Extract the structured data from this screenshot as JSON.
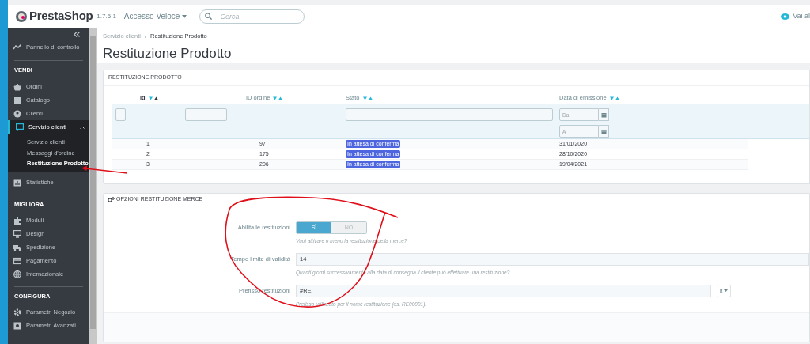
{
  "header": {
    "logo": "PrestaShop",
    "version": "1.7.5.1",
    "quick_access": "Accesso Veloce",
    "search": {
      "placeholder": "Cerca"
    },
    "view_shop": "Vai al"
  },
  "sidebar": {
    "groups": [
      {
        "items": [
          {
            "label": "Pannello di controllo",
            "selected": false
          }
        ]
      },
      {
        "heading": "VENDI",
        "items": [
          {
            "label": "Ordini",
            "selected": false
          },
          {
            "label": "Catalogo",
            "selected": false
          },
          {
            "label": "Clienti",
            "selected": false
          },
          {
            "label": "Servizio clienti",
            "selected": true,
            "expanded": true,
            "children": [
              {
                "label": "Servizio clienti",
                "selected": false
              },
              {
                "label": "Messaggi d'ordine",
                "selected": false
              },
              {
                "label": "Restituzione Prodotto",
                "selected": true
              }
            ]
          },
          {
            "label": "Statistiche",
            "selected": false
          }
        ]
      },
      {
        "heading": "MIGLIORA",
        "items": [
          {
            "label": "Moduli",
            "selected": false
          },
          {
            "label": "Design",
            "selected": false
          },
          {
            "label": "Spedizione",
            "selected": false
          },
          {
            "label": "Pagamento",
            "selected": false
          },
          {
            "label": "Internazionale",
            "selected": false
          }
        ]
      },
      {
        "heading": "CONFIGURA",
        "items": [
          {
            "label": "Parametri Negozio",
            "selected": false
          },
          {
            "label": "Parametri Avanzati",
            "selected": false
          }
        ]
      }
    ]
  },
  "breadcrumb": [
    "Servizio clienti",
    "Restituzione Prodotto"
  ],
  "breadcrumb_separator": "/",
  "page_title": "Restituzione Prodotto",
  "returns_panel": {
    "title": "RESTITUZIONE PRODOTTO",
    "table": {
      "columns": [
        {
          "label": "Id",
          "sorted": true
        },
        {
          "label": "ID ordine",
          "sorted": false
        },
        {
          "label": "Stato",
          "sorted": false
        },
        {
          "label": "Data di emissione",
          "sorted": false
        }
      ],
      "filters": [
        {
          "kind": "checkbox",
          "checked": false
        },
        {
          "kind": "text"
        },
        {
          "kind": "text"
        },
        {
          "kind": "date_range",
          "from_placeholder": "Da",
          "to_placeholder": "A"
        }
      ],
      "rows": [
        {
          "id": "1",
          "order_id": "97",
          "status": "In attesa di conferma",
          "date": "31/01/2020"
        },
        {
          "id": "2",
          "order_id": "175",
          "status": "In attesa di conferma",
          "date": "28/10/2020"
        },
        {
          "id": "3",
          "order_id": "206",
          "status": "In attesa di conferma",
          "date": "19/04/2021"
        }
      ]
    }
  },
  "options_panel": {
    "title": "OPZIONI RESTITUZIONE MERCE",
    "fields": [
      {
        "kind": "toggle",
        "label": "Abilita le restituzioni",
        "options": [
          {
            "label": "SÌ",
            "selected": true
          },
          {
            "label": "NO",
            "selected": false
          }
        ],
        "help": "Vuoi attivare o meno la restituzione della merce?"
      },
      {
        "kind": "text",
        "label": "Tempo limite di validità",
        "value": "14",
        "help": "Quanti giorni successivamente alla data di consegna il cliente può effettuare una restituzione?"
      },
      {
        "kind": "language_text",
        "label": "Prefisso restituzioni",
        "value": "#RE",
        "language": "it",
        "help": "Prefisso utilizzato per il nome restituzione (es. RE00001)."
      }
    ]
  },
  "annotations": [
    {
      "kind": "arrow"
    },
    {
      "kind": "circle"
    }
  ]
}
